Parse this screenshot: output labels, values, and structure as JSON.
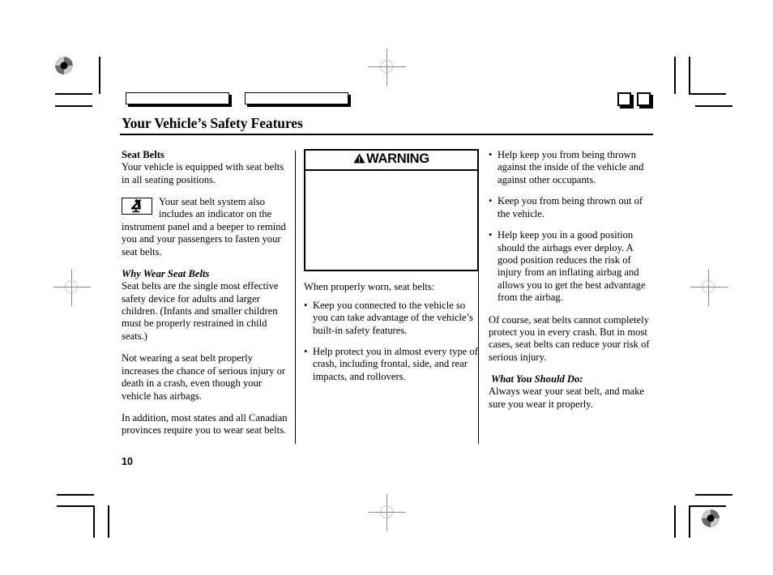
{
  "document": {
    "page_title": "Your Vehicle’s Safety Features",
    "folio": "10"
  },
  "left_column": {
    "heading": "Seat Belts",
    "intro": "Your vehicle is equipped with seat belts in all seating positions.",
    "indicator_icon": "seat-belt-reminder-icon",
    "indicator_paragraph": "Your seat belt system also includes an indicator on the instrument panel and a beeper to remind you and your passengers to fasten your seat belts.",
    "subheading": "Why Wear Seat Belts",
    "paragraphs": [
      "Seat belts are the single most effective safety device for adults and larger children. (Infants and smaller children must be properly restrained in child seats.)",
      "Not wearing a seat belt properly increases the chance of serious injury or death in a crash, even though your vehicle has airbags.",
      "In addition, most states and all Canadian provinces require you to wear seat belts."
    ]
  },
  "middle_column": {
    "warning": {
      "label": "WARNING",
      "icon": "warning-triangle-icon",
      "body": ""
    },
    "lead_in": "When properly worn, seat belts:",
    "bullets": [
      "Keep you connected to the vehicle so you can take advantage of the vehicle’s built-in safety features.",
      "Help protect you in almost every type of crash, including frontal, side, and rear impacts, and rollovers."
    ],
    "bullet_glyph": "•"
  },
  "right_column": {
    "bullets": [
      "Help keep you from being thrown against the inside of the vehicle and against other occupants.",
      "Keep you from being thrown out of the vehicle.",
      "Help keep you in a good position should the airbags ever deploy. A good position reduces the risk of injury from an inflating airbag and allows you to get the best advantage from the airbag."
    ],
    "bullet_glyph": "•",
    "paragraph": "Of course, seat belts cannot completely protect you in every crash. But in most cases, seat belts can reduce your risk of serious injury.",
    "subheading": "What You Should Do:",
    "closing": "Always wear your seat belt, and make sure you wear it properly."
  },
  "print_marks": {
    "registration_target_icon": "registration-target-icon",
    "crosshair_icon": "registration-crosshair-icon",
    "crop_mark_icon": "crop-mark-icon"
  }
}
